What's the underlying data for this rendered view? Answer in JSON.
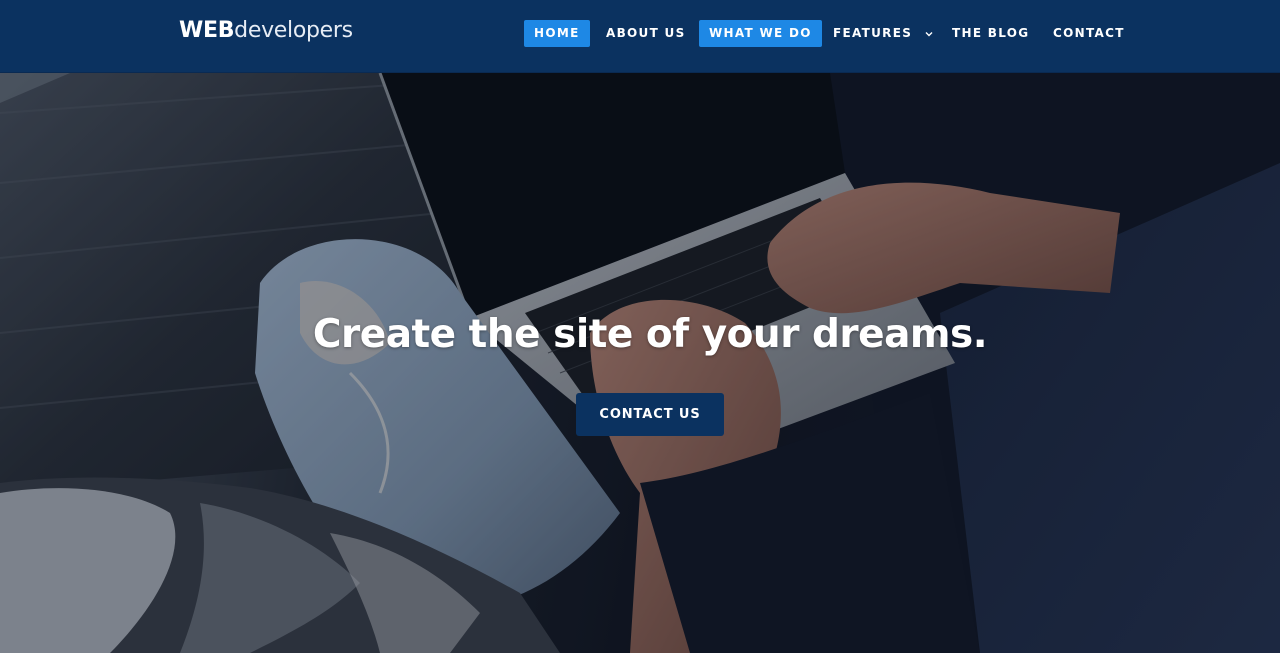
{
  "brand": {
    "strong": "WEB",
    "light": "developers"
  },
  "nav": {
    "items": [
      {
        "label": "HOME",
        "active": true
      },
      {
        "label": "ABOUT US",
        "active": false
      },
      {
        "label": "WHAT WE DO",
        "active": true
      },
      {
        "label": "FEATURES",
        "active": false,
        "has_dropdown": true
      },
      {
        "label": "THE BLOG",
        "active": false
      },
      {
        "label": "CONTACT",
        "active": false
      }
    ]
  },
  "hero": {
    "title": "Create the site of your dreams.",
    "cta_label": "CONTACT US"
  },
  "colors": {
    "header_bg": "#0b3260",
    "nav_active_bg": "#1e88e5",
    "cta_bg": "#0b3260",
    "text": "#ffffff"
  },
  "icons": {
    "dropdown": "chevron-down-icon"
  }
}
